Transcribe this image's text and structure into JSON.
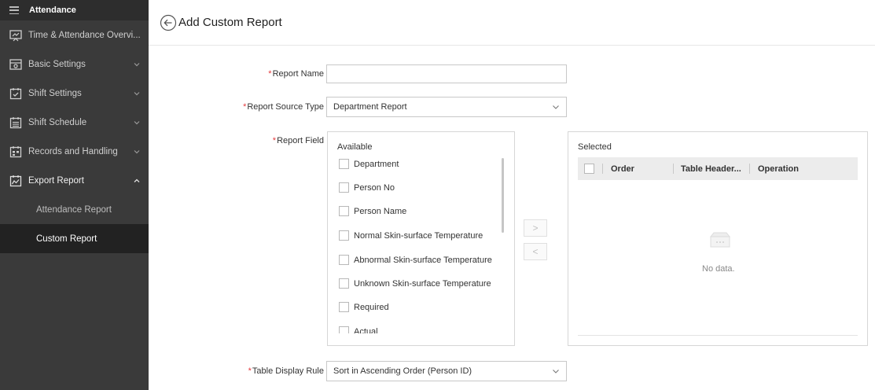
{
  "sidebar": {
    "header": "Attendance",
    "items": [
      {
        "label": "Time & Attendance Overvi...",
        "icon": "overview-icon"
      },
      {
        "label": "Basic Settings",
        "icon": "basic-settings-icon"
      },
      {
        "label": "Shift Settings",
        "icon": "shift-settings-icon"
      },
      {
        "label": "Shift Schedule",
        "icon": "shift-schedule-icon"
      },
      {
        "label": "Records and Handling",
        "icon": "records-icon"
      },
      {
        "label": "Export Report",
        "icon": "export-report-icon"
      }
    ],
    "sub_items": [
      {
        "label": "Attendance Report"
      },
      {
        "label": "Custom Report"
      }
    ]
  },
  "header": {
    "title": "Add Custom Report"
  },
  "form": {
    "report_name_label": "Report Name",
    "report_name_value": "",
    "report_source_label": "Report Source Type",
    "report_source_value": "Department Report",
    "report_field_label": "Report Field",
    "table_display_label": "Table Display Rule",
    "table_display_value": "Sort in Ascending Order (Person ID)",
    "required_mark": "*"
  },
  "available": {
    "title": "Available",
    "items": [
      "Department",
      "Person No",
      "Person Name",
      "Normal Skin-surface Temperature",
      "Abnormal Skin-surface Temperature",
      "Unknown Skin-surface Temperature",
      "Required",
      "Actual"
    ]
  },
  "transfer": {
    "add": ">",
    "remove": "<"
  },
  "selected": {
    "title": "Selected",
    "columns": [
      "Order",
      "Table Header...",
      "Operation"
    ],
    "empty_text": "No data."
  }
}
